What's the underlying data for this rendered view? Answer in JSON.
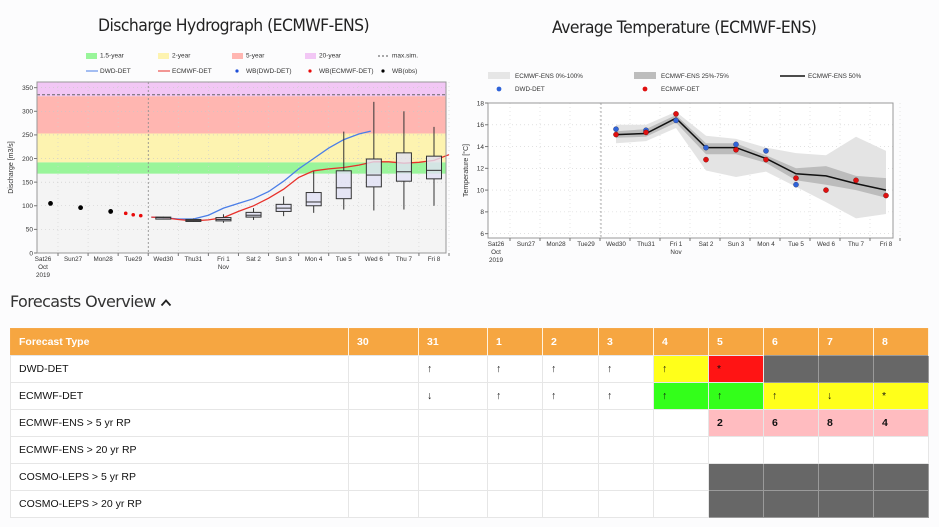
{
  "hydrograph": {
    "title": "Discharge Hydrograph (ECMWF-ENS)",
    "chart_data": {
      "type": "line",
      "title": "Discharge Hydrograph (ECMWF-ENS)",
      "ylabel": "Discharge [m3/s]",
      "xlabel": "",
      "ylim": [
        0,
        362
      ],
      "yticks": [
        0,
        50,
        100,
        150,
        200,
        250,
        300,
        350
      ],
      "x_labels": [
        [
          "Sat26",
          "Oct",
          "2019"
        ],
        [
          "Sun27"
        ],
        [
          "Mon28"
        ],
        [
          "Tue29"
        ],
        [
          "Wed30"
        ],
        [
          "Thu31"
        ],
        [
          "Fri 1",
          "Nov"
        ],
        [
          "Sat 2"
        ],
        [
          "Sun 3"
        ],
        [
          "Mon 4"
        ],
        [
          "Tue 5"
        ],
        [
          "Wed 6"
        ],
        [
          "Thu 7"
        ],
        [
          "Fri 8"
        ]
      ],
      "forecast_start_index": 3.5,
      "threshold_bands": [
        {
          "name": "1.5-year",
          "from": 168,
          "to": 192,
          "color": "#99f59a"
        },
        {
          "name": "2-year",
          "from": 192,
          "to": 253,
          "color": "#fdf3b0"
        },
        {
          "name": "5-year",
          "from": 253,
          "to": 332,
          "color": "#ffb6b1"
        },
        {
          "name": "20-year",
          "from": 332,
          "to": 362,
          "color": "#f2c7f5"
        }
      ],
      "max_sim": 335,
      "legend": [
        {
          "label": "1.5-year",
          "kind": "patch",
          "color": "#99f59a"
        },
        {
          "label": "2-year",
          "kind": "patch",
          "color": "#fdf3b0"
        },
        {
          "label": "5-year",
          "kind": "patch",
          "color": "#ffb6b1"
        },
        {
          "label": "20-year",
          "kind": "patch",
          "color": "#f2c7f5"
        },
        {
          "label": "max.sim.",
          "kind": "dash",
          "color": "#555555"
        },
        {
          "label": "DWD-DET",
          "kind": "line",
          "color": "#4a7ee8"
        },
        {
          "label": "ECMWF-DET",
          "kind": "line",
          "color": "#e8302a"
        },
        {
          "label": "WB(DWD-DET)",
          "kind": "dot",
          "color": "#1f4fd8"
        },
        {
          "label": "WB(ECMWF-DET)",
          "kind": "dot",
          "color": "#e80a0a"
        },
        {
          "label": "WB(obs)",
          "kind": "dot",
          "color": "#000000"
        }
      ],
      "series": [
        {
          "name": "WB(obs)",
          "x": [
            0.25,
            1.25,
            2.25
          ],
          "values": [
            105,
            96,
            88
          ]
        },
        {
          "name": "WB(ECMWF-DET)",
          "x": [
            2.75,
            3.0,
            3.25
          ],
          "values": [
            84,
            81,
            79
          ]
        },
        {
          "name": "DWD-DET",
          "x": [
            3.6,
            4,
            4.5,
            5,
            5.5,
            6,
            6.5,
            7,
            7.5,
            8,
            8.5,
            9,
            9.5,
            10,
            10.5,
            10.9
          ],
          "values": [
            76,
            75,
            72,
            72,
            80,
            95,
            105,
            115,
            130,
            152,
            178,
            200,
            222,
            240,
            252,
            258
          ]
        },
        {
          "name": "ECMWF-DET",
          "x": [
            3.6,
            4,
            4.5,
            5,
            5.5,
            6,
            6.5,
            7,
            7.5,
            8,
            8.5,
            9,
            9.5,
            10,
            10.5,
            11,
            11.5,
            12,
            12.5,
            13,
            13.5
          ],
          "values": [
            76,
            75,
            71,
            68,
            70,
            75,
            88,
            100,
            116,
            135,
            160,
            174,
            178,
            181,
            186,
            193,
            193,
            190,
            192,
            196,
            208
          ]
        }
      ],
      "boxplots": [
        {
          "x": 4,
          "min": 73,
          "q1": 74,
          "median": 75,
          "q3": 76,
          "max": 77
        },
        {
          "x": 5,
          "min": 66,
          "q1": 68,
          "median": 69,
          "q3": 71,
          "max": 73
        },
        {
          "x": 6,
          "min": 64,
          "q1": 68,
          "median": 71,
          "q3": 75,
          "max": 82
        },
        {
          "x": 7,
          "min": 70,
          "q1": 76,
          "median": 80,
          "q3": 86,
          "max": 95
        },
        {
          "x": 8,
          "min": 78,
          "q1": 88,
          "median": 95,
          "q3": 103,
          "max": 120
        },
        {
          "x": 9,
          "min": 85,
          "q1": 100,
          "median": 108,
          "q3": 128,
          "max": 173
        },
        {
          "x": 10,
          "min": 92,
          "q1": 115,
          "median": 138,
          "q3": 174,
          "max": 257
        },
        {
          "x": 11,
          "min": 90,
          "q1": 140,
          "median": 165,
          "q3": 199,
          "max": 320
        },
        {
          "x": 12,
          "min": 92,
          "q1": 152,
          "median": 172,
          "q3": 212,
          "max": 300
        },
        {
          "x": 13,
          "min": 100,
          "q1": 157,
          "median": 175,
          "q3": 205,
          "max": 267
        }
      ]
    }
  },
  "temperature": {
    "title": "Average Temperature (ECMWF-ENS)",
    "chart_data": {
      "type": "line",
      "title": "Average Temperature (ECMWF-ENS)",
      "ylabel": "Temperature [°C]",
      "xlabel": "",
      "ylim": [
        5.6,
        18
      ],
      "yticks": [
        6,
        8,
        10,
        12,
        14,
        16,
        18
      ],
      "x_labels": [
        [
          "Sat26",
          "Oct",
          "2019"
        ],
        [
          "Sun27"
        ],
        [
          "Mon28"
        ],
        [
          "Tue29"
        ],
        [
          "Wed30"
        ],
        [
          "Thu31"
        ],
        [
          "Fri 1",
          "Nov"
        ],
        [
          "Sat 2"
        ],
        [
          "Sun 3"
        ],
        [
          "Mon 4"
        ],
        [
          "Tue 5"
        ],
        [
          "Wed 6"
        ],
        [
          "Thu 7"
        ],
        [
          "Fri 8"
        ]
      ],
      "forecast_start_index": 3.5,
      "legend": [
        {
          "label": "ECMWF-ENS  0%-100%",
          "kind": "patch",
          "color": "#e6e6e6"
        },
        {
          "label": "ECMWF-ENS 25%-75%",
          "kind": "patch",
          "color": "#bdbdbd"
        },
        {
          "label": "ECMWF-ENS 50%",
          "kind": "line",
          "color": "#111111"
        },
        {
          "label": "DWD-DET",
          "kind": "dot",
          "color": "#2f63d8"
        },
        {
          "label": "ECMWF-DET",
          "kind": "dot",
          "color": "#e01010"
        }
      ],
      "x": [
        4,
        5,
        6,
        7,
        8,
        9,
        10,
        11,
        12,
        13
      ],
      "series": [
        {
          "name": "ECMWF-ENS 50%",
          "values": [
            15.1,
            15.2,
            16.6,
            13.9,
            13.9,
            12.9,
            11.5,
            11.3,
            10.6,
            10.0
          ]
        },
        {
          "name": "ECMWF-ENS 0% (min)",
          "values": [
            14.3,
            14.5,
            15.7,
            11.8,
            11.2,
            11.7,
            10.3,
            8.9,
            7.4,
            7.8
          ]
        },
        {
          "name": "ECMWF-ENS 100% (max)",
          "values": [
            16.0,
            16.0,
            17.2,
            15.0,
            14.7,
            13.9,
            13.4,
            13.2,
            14.9,
            13.6
          ]
        },
        {
          "name": "ECMWF-ENS 25%",
          "values": [
            14.8,
            14.9,
            16.2,
            13.3,
            13.3,
            12.5,
            10.9,
            10.5,
            10.0,
            9.3
          ]
        },
        {
          "name": "ECMWF-ENS 75%",
          "values": [
            15.4,
            15.6,
            16.9,
            14.3,
            14.3,
            13.2,
            12.0,
            12.2,
            11.3,
            11.1
          ]
        },
        {
          "name": "DWD-DET",
          "values": [
            15.6,
            15.5,
            16.4,
            13.9,
            14.2,
            13.6,
            10.5,
            null,
            null,
            null
          ]
        },
        {
          "name": "ECMWF-DET",
          "values": [
            15.1,
            15.3,
            17.0,
            12.8,
            13.7,
            12.8,
            11.1,
            10.0,
            10.9,
            9.5
          ]
        }
      ]
    }
  },
  "overview": {
    "title": "Forecasts Overview",
    "toggle_icon": "chevron-up-icon",
    "columns": [
      "Forecast Type",
      "30",
      "31",
      "1",
      "2",
      "3",
      "4",
      "5",
      "6",
      "7",
      "8"
    ],
    "rows": [
      {
        "type": "DWD-DET",
        "cells": [
          {
            "v": ""
          },
          {
            "v": "↑"
          },
          {
            "v": "↑"
          },
          {
            "v": "↑"
          },
          {
            "v": "↑"
          },
          {
            "v": "↑",
            "c": "yellow"
          },
          {
            "v": "*",
            "c": "red"
          },
          {
            "v": "",
            "c": "grey"
          },
          {
            "v": "",
            "c": "grey"
          },
          {
            "v": "",
            "c": "grey"
          }
        ]
      },
      {
        "type": "ECMWF-DET",
        "cells": [
          {
            "v": ""
          },
          {
            "v": "↓"
          },
          {
            "v": "↑"
          },
          {
            "v": "↑"
          },
          {
            "v": "↑"
          },
          {
            "v": "↑",
            "c": "green"
          },
          {
            "v": "↑",
            "c": "green"
          },
          {
            "v": "↑",
            "c": "yellow"
          },
          {
            "v": "↓",
            "c": "yellow"
          },
          {
            "v": "*",
            "c": "yellow"
          }
        ]
      },
      {
        "type": "ECMWF-ENS > 5 yr RP",
        "cells": [
          {
            "v": ""
          },
          {
            "v": ""
          },
          {
            "v": ""
          },
          {
            "v": ""
          },
          {
            "v": ""
          },
          {
            "v": ""
          },
          {
            "v": "2",
            "c": "pink"
          },
          {
            "v": "6",
            "c": "pink"
          },
          {
            "v": "8",
            "c": "pink"
          },
          {
            "v": "4",
            "c": "pink"
          }
        ]
      },
      {
        "type": "ECMWF-ENS > 20 yr RP",
        "cells": [
          {
            "v": ""
          },
          {
            "v": ""
          },
          {
            "v": ""
          },
          {
            "v": ""
          },
          {
            "v": ""
          },
          {
            "v": ""
          },
          {
            "v": ""
          },
          {
            "v": ""
          },
          {
            "v": ""
          },
          {
            "v": ""
          }
        ]
      },
      {
        "type": "COSMO-LEPS > 5 yr RP",
        "cells": [
          {
            "v": ""
          },
          {
            "v": ""
          },
          {
            "v": ""
          },
          {
            "v": ""
          },
          {
            "v": ""
          },
          {
            "v": ""
          },
          {
            "v": "",
            "c": "grey"
          },
          {
            "v": "",
            "c": "grey"
          },
          {
            "v": "",
            "c": "grey"
          },
          {
            "v": "",
            "c": "grey"
          }
        ]
      },
      {
        "type": "COSMO-LEPS > 20 yr RP",
        "cells": [
          {
            "v": ""
          },
          {
            "v": ""
          },
          {
            "v": ""
          },
          {
            "v": ""
          },
          {
            "v": ""
          },
          {
            "v": ""
          },
          {
            "v": "",
            "c": "grey"
          },
          {
            "v": "",
            "c": "grey"
          },
          {
            "v": "",
            "c": "grey"
          },
          {
            "v": "",
            "c": "grey"
          }
        ]
      }
    ]
  }
}
